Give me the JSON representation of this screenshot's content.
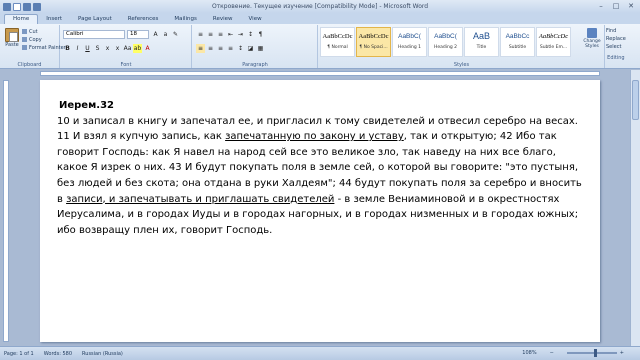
{
  "window": {
    "title": "Откровение. Текущее изучение [Compatibility Mode] - Microsoft Word",
    "minimize": "–",
    "maximize": "□",
    "close": "✕"
  },
  "tabs": [
    "Home",
    "Insert",
    "Page Layout",
    "References",
    "Mailings",
    "Review",
    "View"
  ],
  "ribbon": {
    "clipboard": {
      "paste": "Paste",
      "cut": "Cut",
      "copy": "Copy",
      "format_painter": "Format Painter",
      "label": "Clipboard"
    },
    "font": {
      "family": "Calibri",
      "size": "18",
      "label": "Font",
      "bold": "B",
      "italic": "I",
      "underline": "U"
    },
    "paragraph": {
      "label": "Paragraph"
    },
    "styles": {
      "label": "Styles",
      "items": [
        {
          "sample": "AaBbCcDc",
          "name": "¶ Normal"
        },
        {
          "sample": "AaBbCcDc",
          "name": "¶ No Spaci..."
        },
        {
          "sample": "AaBbC(",
          "name": "Heading 1"
        },
        {
          "sample": "AaBbC(",
          "name": "Heading 2"
        },
        {
          "sample": "AaB",
          "name": "Title"
        },
        {
          "sample": "AaBbCc",
          "name": "Subtitle"
        },
        {
          "sample": "AaBbCcDc",
          "name": "Subtle Em..."
        }
      ],
      "change_styles": "Change Styles"
    },
    "editing": {
      "find": "Find",
      "replace": "Replace",
      "select": "Select",
      "label": "Editing"
    }
  },
  "document": {
    "heading": "Иерем.32",
    "p1": "10 и записал в книгу и запечатал ее, и пригласил к тому свидетелей и отвесил серебро на весах. 11 И взял я купчую запись, как ",
    "u1": "запечатанную по закону и уставу",
    "p2": ", так и открытую; 42 Ибо так говорит Господь: как Я навел на народ сей все это великое зло, так наведу на них все благо, какое Я изрек о них. 43 И будут покупать поля в земле сей, о которой вы говорите: \"это пустыня, без людей и без скота; она отдана в руки Халдеям\"; 44 будут покупать поля за серебро и вносить в ",
    "u2": "записи, и запечатывать и приглашать свидетелей",
    "p3": " - в земле Вениаминовой и в окрестностях Иерусалима, и в городах Иуды и в городах нагорных, и в городах низменных и в городах южных; ибо возвращу плен их, говорит Господь."
  },
  "status": {
    "page": "Page: 1 of 1",
    "words": "Words: 580",
    "language": "Russian (Russia)",
    "zoom": "108%",
    "zoom_level": 0.54
  }
}
